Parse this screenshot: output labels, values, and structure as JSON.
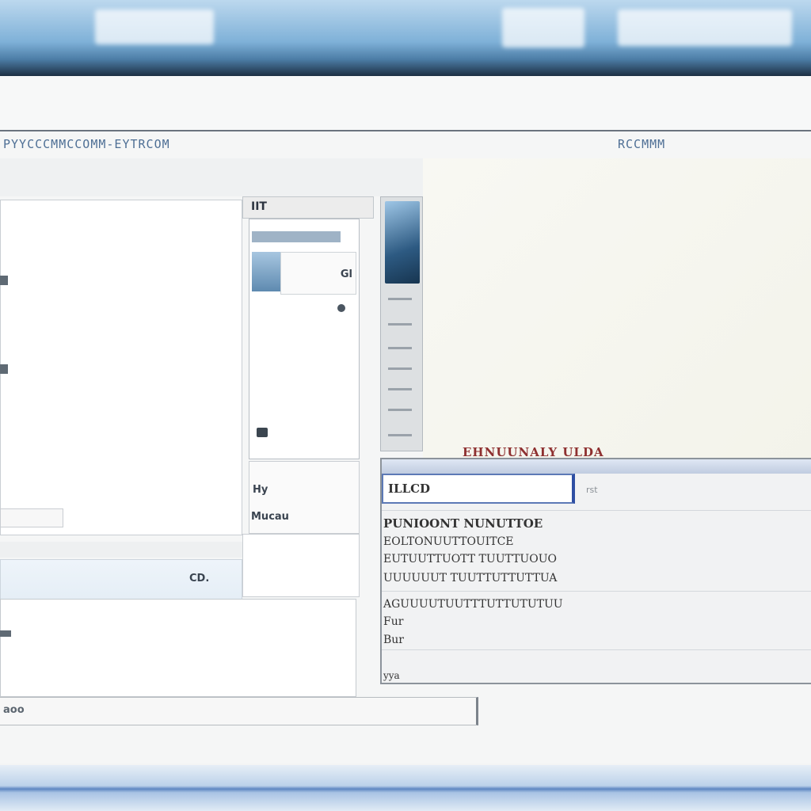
{
  "window": {
    "title": "PYYCCCMMCCOMM-EYTRCOM",
    "title_right": "RCCMMM"
  },
  "panels": {
    "column_header": "IIT",
    "mid_button": "Gl",
    "mid_lower_label_1": "Hy",
    "mid_lower_label_2": "Mucau",
    "left_row_label": "CD.",
    "bottom_left_label": "aoo"
  },
  "results": {
    "title": "EHNUUNALY ULDA",
    "search_value": "ILLCD",
    "search_hint": "rst",
    "lines": [
      "PUNIOONT NUNUTTOE",
      "EOLTONUUTTOUITCE",
      "EUTUUTTUOTT TUUTTUOUO",
      "UUUUUUT TUUTTUTTUTTUA",
      "AGUUUUTUUTTTUTTUTUTUU",
      "Fur",
      "Bur"
    ],
    "footer": "yya"
  },
  "colors": {
    "accent_blue": "#2f4fa3",
    "title_blue": "#4e6f95",
    "result_title_red": "#8e3030"
  }
}
